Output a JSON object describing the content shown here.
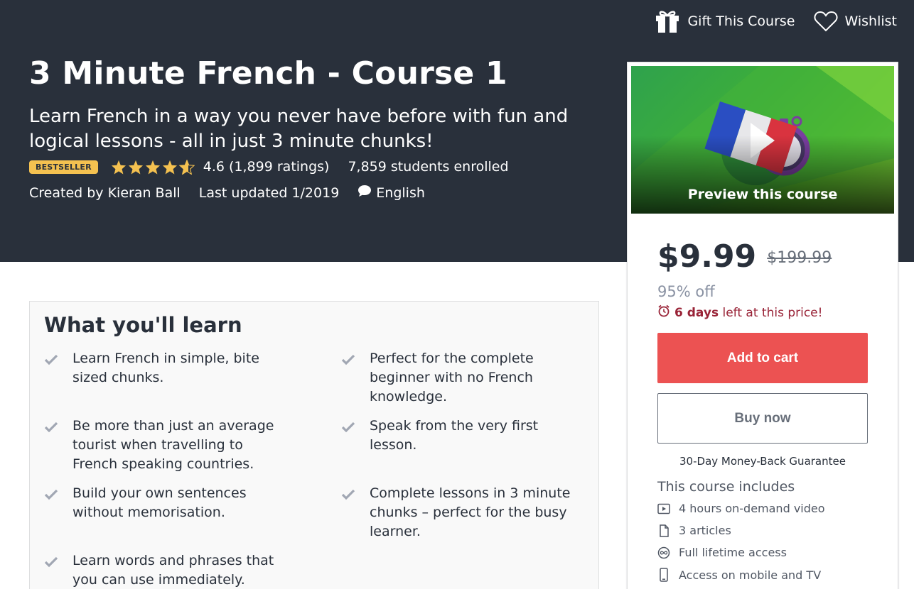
{
  "header": {
    "gift_label": "Gift This Course",
    "wishlist_label": "Wishlist",
    "title": "3 Minute French - Course 1",
    "subtitle": "Learn French in a way you never have before with fun and logical lessons - all in just 3 minute chunks!",
    "badge": "BESTSELLER",
    "rating": "4.6 (1,899 ratings)",
    "stars_value": 4.6,
    "enrolled": "7,859 students enrolled",
    "created_by": "Created by Kieran Ball",
    "last_updated": "Last updated 1/2019",
    "language": "English"
  },
  "learn": {
    "title": "What you'll learn",
    "items": [
      "Learn French in simple, bite sized chunks.",
      "Perfect for the complete beginner with no French knowledge.",
      "Be more than just an average tourist when travelling to French speaking countries.",
      "Speak from the very first lesson.",
      "Build your own sentences without memorisation.",
      "Complete lessons in 3 minute chunks – perfect for the busy learner.",
      "Learn words and phrases that you can use immediately."
    ]
  },
  "sidebar": {
    "preview_label": "Preview this course",
    "price": "$9.99",
    "old_price": "$199.99",
    "discount": "95% off",
    "timer_days": "6 days",
    "timer_text": " left at this price!",
    "add_to_cart": "Add to cart",
    "buy_now": "Buy now",
    "guarantee": "30-Day Money-Back Guarantee",
    "includes_title": "This course includes",
    "includes": [
      {
        "icon": "video-icon",
        "label": "4 hours on-demand video"
      },
      {
        "icon": "file-icon",
        "label": "3 articles"
      },
      {
        "icon": "infinity-icon",
        "label": "Full lifetime access"
      },
      {
        "icon": "mobile-icon",
        "label": "Access on mobile and TV"
      }
    ]
  },
  "colors": {
    "hero_bg": "#29303b",
    "badge": "#f4c150",
    "star": "#f4c150",
    "cart_button": "#ec5252",
    "timer": "#992337"
  }
}
